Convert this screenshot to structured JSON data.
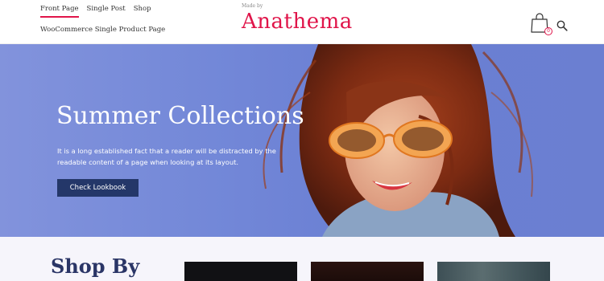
{
  "nav": {
    "items": [
      "Front Page",
      "Single Post",
      "Shop"
    ],
    "secondary": "WooCommerce Single Product Page"
  },
  "brand": {
    "made_by": "Made by",
    "name": "Anathema",
    "color": "#e0154a"
  },
  "cart": {
    "icon": "shopping-bag-icon",
    "count": "0"
  },
  "search": {
    "icon": "search-icon"
  },
  "hero": {
    "title": "Summer Collections",
    "text": "It is a long established fact that a reader will be distracted by the readable content of a page when looking at its layout.",
    "button": "Check Lookbook",
    "background": "#7388d8",
    "button_color": "#243769"
  },
  "shop": {
    "title": "Shop By"
  }
}
